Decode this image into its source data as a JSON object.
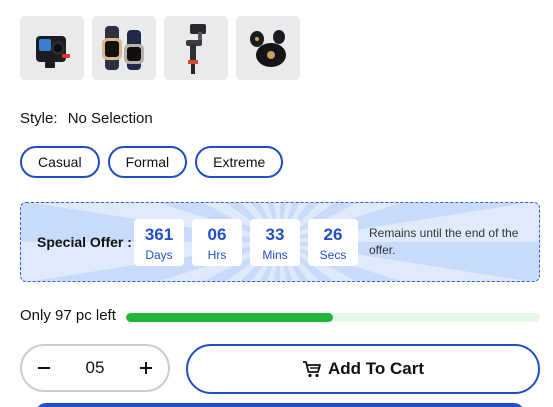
{
  "thumbnails": [
    {
      "icon": "action-camera-icon"
    },
    {
      "icon": "smartwatch-icon"
    },
    {
      "icon": "gimbal-icon"
    },
    {
      "icon": "earbuds-icon"
    }
  ],
  "style": {
    "label": "Style:",
    "value": "No Selection",
    "options": [
      "Casual",
      "Formal",
      "Extreme"
    ]
  },
  "offer": {
    "label": "Special Offer :",
    "timer": [
      {
        "num": "361",
        "unit": "Days"
      },
      {
        "num": "06",
        "unit": "Hrs"
      },
      {
        "num": "33",
        "unit": "Mins"
      },
      {
        "num": "26",
        "unit": "Secs"
      }
    ],
    "note": "Remains until the end of the offer."
  },
  "stock": {
    "text": "Only 97 pc left",
    "fill_fraction": 0.5
  },
  "quantity": {
    "value": "05"
  },
  "cart": {
    "label": "Add To Cart"
  },
  "colors": {
    "accent": "#1e4fc4",
    "stock_fill": "#22b53b"
  }
}
